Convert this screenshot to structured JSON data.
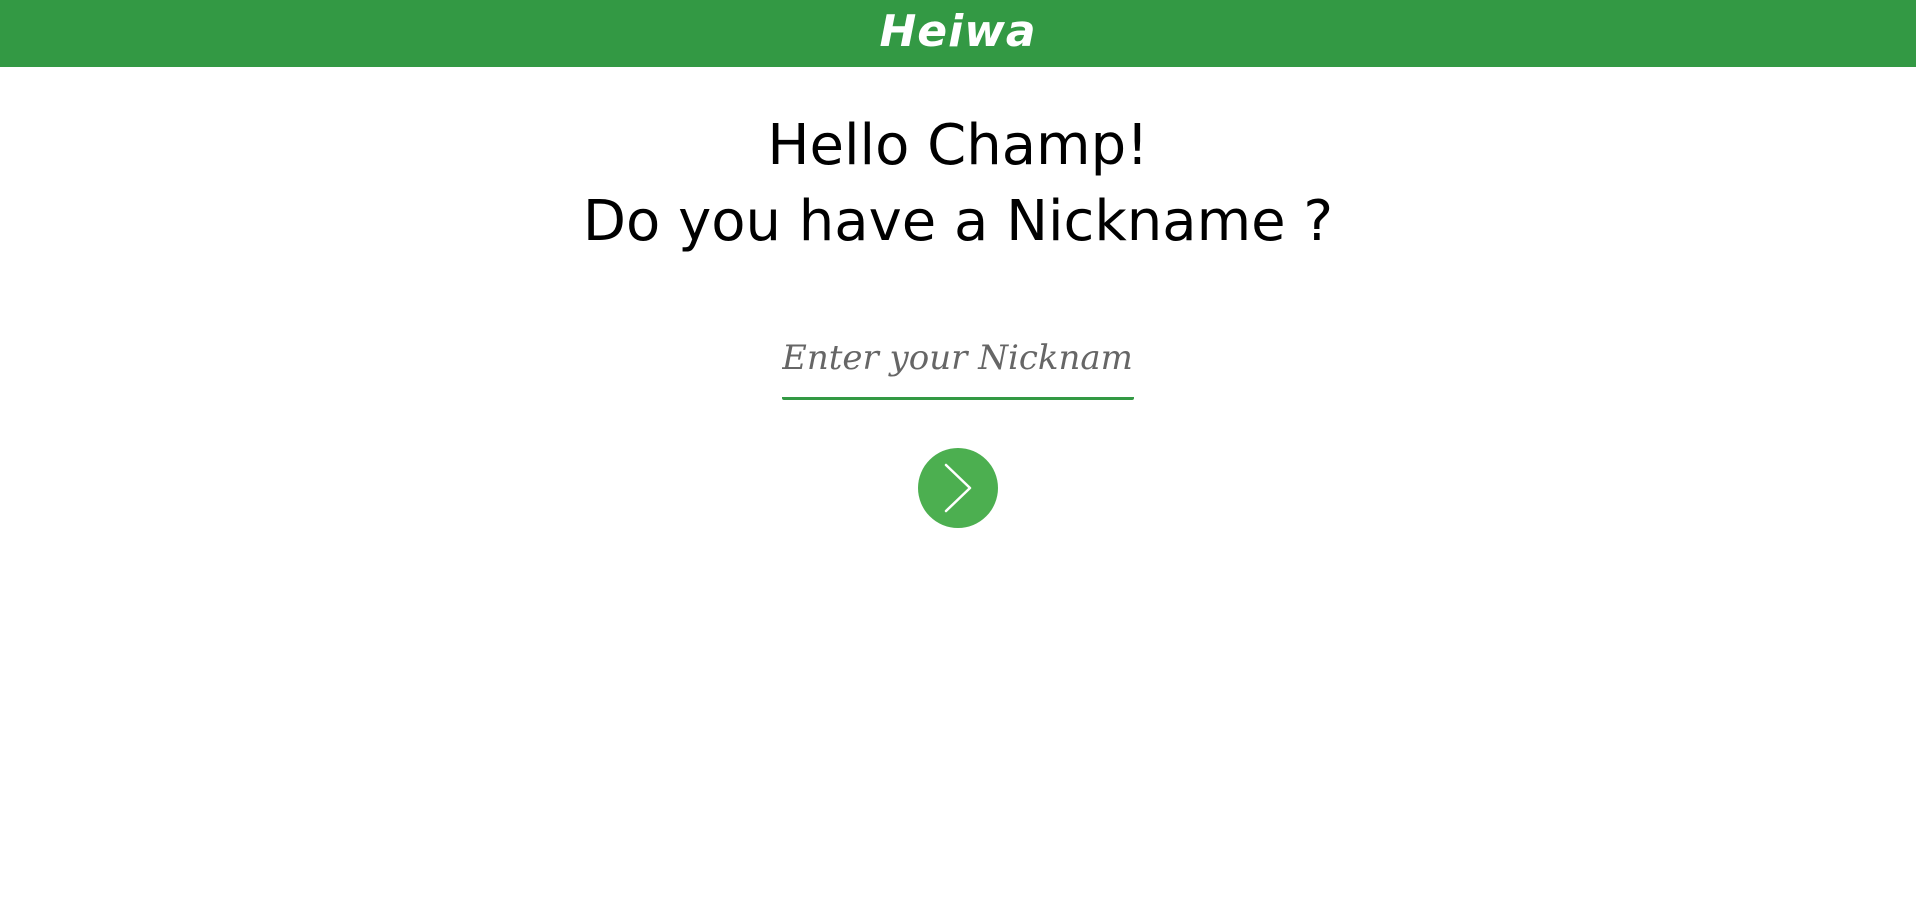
{
  "header": {
    "brand": "Heiwa",
    "background_color": "#339944"
  },
  "greeting": {
    "line1": "Hello Champ!",
    "line2": "Do you have a Nickname ?"
  },
  "nickname": {
    "placeholder": "Enter your Nickname",
    "value": "",
    "underline_color": "#339944"
  },
  "next_button": {
    "icon": "chevron-right-icon",
    "background_color": "#4caf50"
  }
}
